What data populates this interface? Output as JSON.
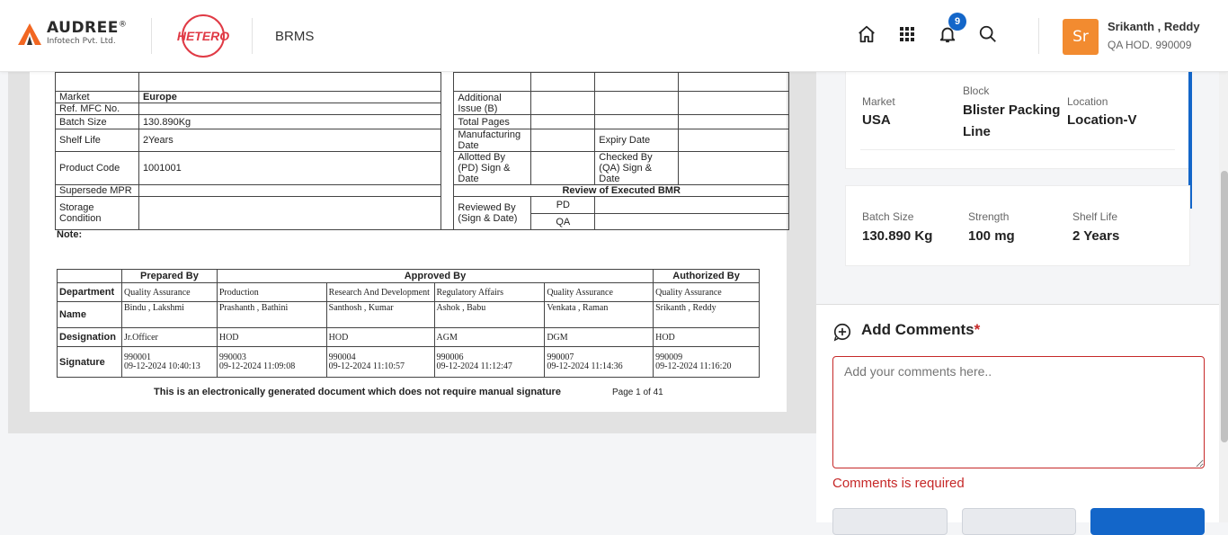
{
  "header": {
    "logo_name": "AUDREE",
    "logo_reg": "®",
    "logo_sub": "Infotech Pvt. Ltd.",
    "partner_logo": "HETERO",
    "app_title": "BRMS",
    "notification_count": "9",
    "user_initials": "Sr",
    "user_name": "Srikanth , Reddy",
    "user_role": "QA HOD. 990009",
    "icons": [
      "home-icon",
      "apps-grid-icon",
      "bell-icon",
      "search-icon"
    ]
  },
  "document": {
    "rows_left": [
      {
        "label": "Market",
        "value": "Europe"
      },
      {
        "label": "Ref. MFC No.",
        "value": ""
      },
      {
        "label": "Batch Size",
        "value": "130.890Kg"
      },
      {
        "label": "Shelf Life",
        "value": "2Years"
      },
      {
        "label": "Product Code",
        "value": "1001001"
      },
      {
        "label": "Supersede MPR",
        "value": ""
      },
      {
        "label": "Storage Condition",
        "value": ""
      }
    ],
    "right": {
      "additional_issue": "Additional Issue (B)",
      "total_pages": "Total Pages",
      "manufacturing_date": "Manufacturing Date",
      "expiry_date": "Expiry Date",
      "allotted_by": "Allotted By (PD) Sign & Date",
      "checked_by": "Checked By (QA) Sign & Date",
      "review_title": "Review of Executed BMR",
      "reviewed_by": "Reviewed By (Sign & Date)",
      "pd": "PD",
      "qa": "QA"
    },
    "note": "Note:",
    "sign_table": {
      "prepared_by": "Prepared By",
      "approved_by": "Approved By",
      "authorized_by": "Authorized By",
      "row_labels": [
        "Department",
        "Name",
        "Designation",
        "Signature"
      ],
      "columns": [
        {
          "department": "Quality Assurance",
          "name": "Bindu , Lakshmi",
          "designation": "Jr.Officer",
          "sig_id": "990001",
          "sig_time": "09-12-2024 10:40:13"
        },
        {
          "department": "Production",
          "name": "Prashanth , Bathini",
          "designation": "HOD",
          "sig_id": "990003",
          "sig_time": "09-12-2024 11:09:08"
        },
        {
          "department": "Research And Development",
          "name": "Santhosh , Kumar",
          "designation": "HOD",
          "sig_id": "990004",
          "sig_time": "09-12-2024 11:10:57"
        },
        {
          "department": "Regulatory Affairs",
          "name": "Ashok , Babu",
          "designation": "AGM",
          "sig_id": "990006",
          "sig_time": "09-12-2024 11:12:47"
        },
        {
          "department": "Quality Assurance",
          "name": "Venkata , Raman",
          "designation": "DGM",
          "sig_id": "990007",
          "sig_time": "09-12-2024 11:14:36"
        },
        {
          "department": "Quality Assurance",
          "name": "Srikanth , Reddy",
          "designation": "HOD",
          "sig_id": "990009",
          "sig_time": "09-12-2024 11:16:20"
        }
      ]
    },
    "footer_text": "This is an electronically generated document which does not require manual signature",
    "page_info": "Page 1 of 41"
  },
  "details": {
    "market_label": "Market",
    "market_value": "USA",
    "block_label": "Block",
    "block_value_1": "Blister Packing",
    "block_value_2": "Line",
    "location_label": "Location",
    "location_value": "Location-V",
    "batch_size_label": "Batch Size",
    "batch_size_value": "130.890 Kg",
    "strength_label": "Strength",
    "strength_value": "100 mg",
    "shelf_life_label": "Shelf Life",
    "shelf_life_value": "2 Years"
  },
  "comments": {
    "title": "Add Comments",
    "required_mark": "*",
    "placeholder": "Add your comments here..",
    "error": "Comments is required"
  },
  "colors": {
    "accent": "#1366c9",
    "error": "#c62828",
    "avatar": "#f28b30",
    "hetero": "#e03a45"
  }
}
